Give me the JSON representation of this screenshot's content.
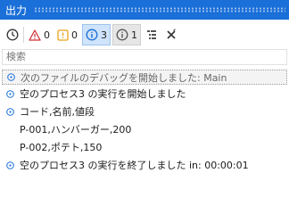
{
  "window": {
    "title": "出力"
  },
  "toolbar": {
    "error_count": "0",
    "warning_count": "0",
    "info_count": "3",
    "trace_count": "1"
  },
  "search": {
    "placeholder": "検索"
  },
  "log": {
    "entries": [
      {
        "type": "debug",
        "text": "次のファイルのデバッグを開始しました: Main"
      },
      {
        "type": "info",
        "text": "空のプロセス3 の実行を開始しました"
      },
      {
        "type": "info",
        "text": "コード,名前,値段"
      },
      {
        "type": "continuation",
        "text": "P-001,ハンバーガー,200"
      },
      {
        "type": "continuation",
        "text": "P-002,ポテト,150"
      },
      {
        "type": "info",
        "text": "空のプロセス3 の実行を終了しました in: 00:00:01"
      }
    ]
  },
  "colors": {
    "accent": "#1a6fd8",
    "error": "#d13438",
    "warning": "#e8a317",
    "info": "#1a6fd8"
  }
}
